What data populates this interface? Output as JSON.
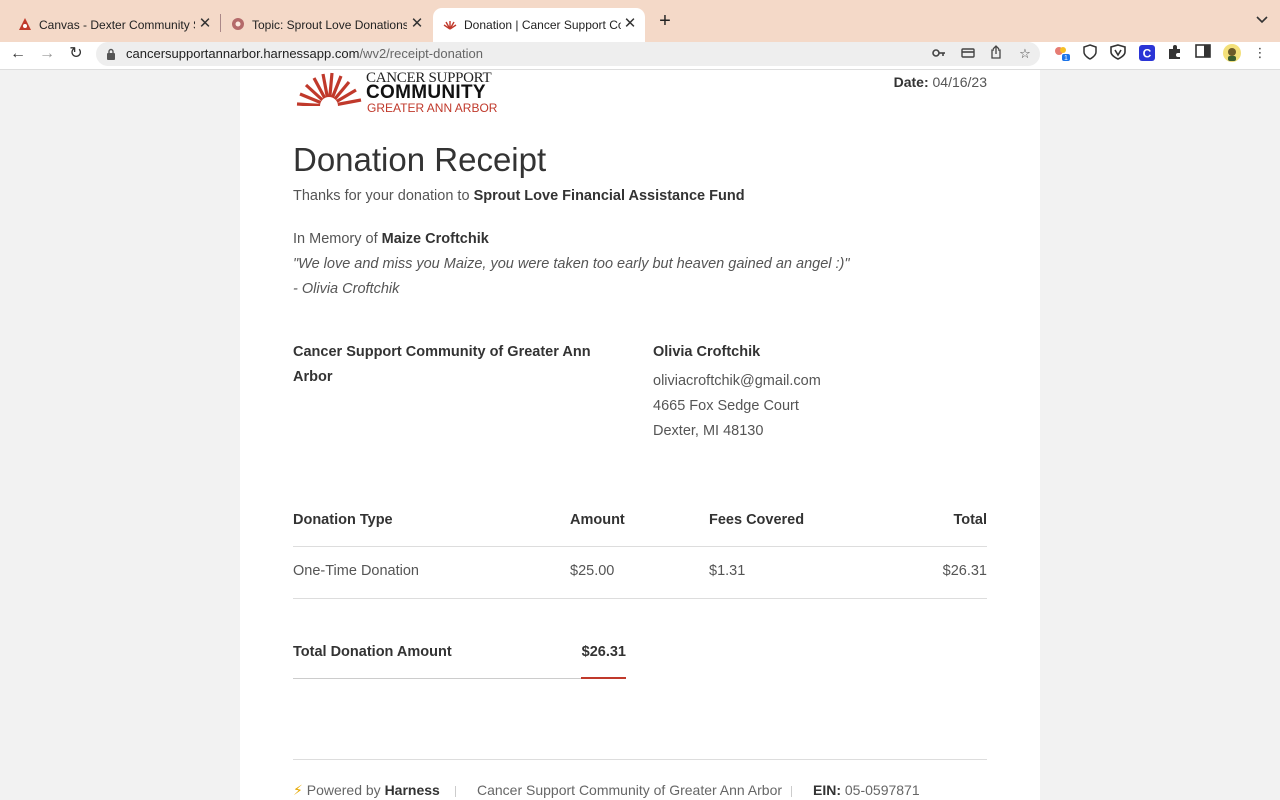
{
  "browser": {
    "tabs": [
      {
        "title": "Canvas - Dexter Community Sc",
        "active": false
      },
      {
        "title": "Topic: Sprout Love Donations!",
        "active": false
      },
      {
        "title": "Donation | Cancer Support Con",
        "active": true
      }
    ],
    "url_host": "cancersupportannarbor.harnessapp.com",
    "url_path": "/wv2/receipt-donation",
    "extension_badge": "1",
    "extension_c_label": "C"
  },
  "logo": {
    "line1": "CANCER SUPPORT",
    "line2": "COMMUNITY",
    "line3": "GREATER ANN ARBOR",
    "brand_color": "#c0392b"
  },
  "receipt": {
    "date_label": "Date:",
    "date_value": "04/16/23",
    "title": "Donation Receipt",
    "thanks_prefix": "Thanks for your donation to",
    "fund_name": "Sprout Love Financial Assistance Fund",
    "memory_prefix": "In Memory of",
    "memory_name": "Maize Croftchik",
    "quote": "\"We love and miss you Maize, you were taken too early but heaven gained an angel :)\"",
    "quote_signature": "- Olivia Croftchik"
  },
  "organization": {
    "name": "Cancer Support Community of Greater Ann Arbor"
  },
  "donor": {
    "name": "Olivia Croftchik",
    "email": "oliviacroftchik@gmail.com",
    "address1": "4665 Fox Sedge Court",
    "address2": "Dexter, MI 48130"
  },
  "table": {
    "headers": [
      "Donation Type",
      "Amount",
      "Fees Covered",
      "Total"
    ],
    "rows": [
      [
        "One-Time Donation",
        "$25.00",
        "$1.31",
        "$26.31"
      ]
    ],
    "total_label": "Total Donation Amount",
    "total_value": "$26.31"
  },
  "footer": {
    "powered_prefix": "Powered by",
    "powered_brand": "Harness",
    "org_name": "Cancer Support Community of Greater Ann Arbor",
    "ein_label": "EIN:",
    "ein_value": "05-0597871"
  }
}
